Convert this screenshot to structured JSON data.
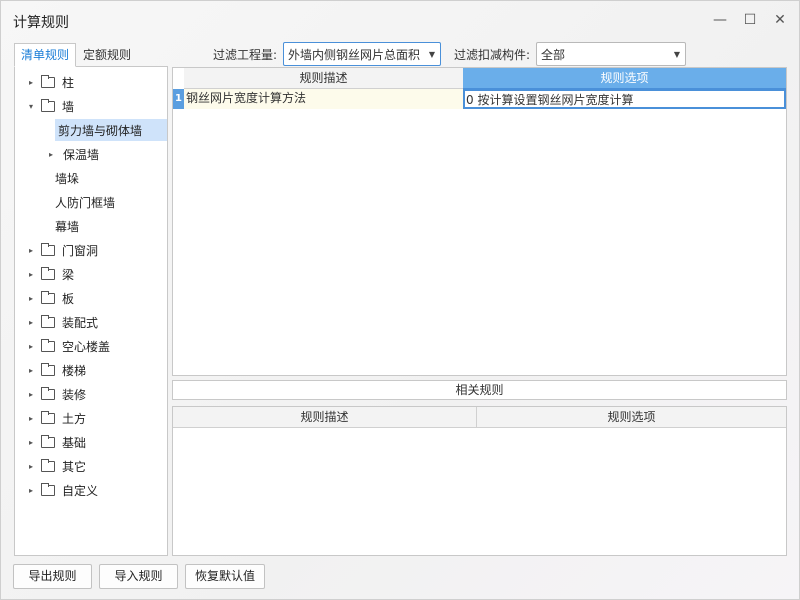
{
  "window": {
    "title": "计算规则"
  },
  "tabs": [
    {
      "label": "清单规则",
      "active": true
    },
    {
      "label": "定额规则",
      "active": false
    }
  ],
  "filters": {
    "quantity_label": "过滤工程量:",
    "quantity_value": "外墙内侧钢丝网片总面积",
    "component_label": "过滤扣减构件:",
    "component_value": "全部"
  },
  "tree": [
    {
      "label": "柱",
      "expandable": true,
      "expanded": false,
      "folder": true,
      "level": 0
    },
    {
      "label": "墙",
      "expandable": true,
      "expanded": true,
      "folder": true,
      "level": 0
    },
    {
      "label": "剪力墙与砌体墙",
      "expandable": false,
      "folder": false,
      "level": 1,
      "selected": true
    },
    {
      "label": "保温墙",
      "expandable": true,
      "expanded": false,
      "folder": false,
      "level": 1
    },
    {
      "label": "墙垛",
      "expandable": false,
      "folder": false,
      "level": 1
    },
    {
      "label": "人防门框墙",
      "expandable": false,
      "folder": false,
      "level": 1
    },
    {
      "label": "幕墙",
      "expandable": false,
      "folder": false,
      "level": 1
    },
    {
      "label": "门窗洞",
      "expandable": true,
      "expanded": false,
      "folder": true,
      "level": 0
    },
    {
      "label": "梁",
      "expandable": true,
      "expanded": false,
      "folder": true,
      "level": 0
    },
    {
      "label": "板",
      "expandable": true,
      "expanded": false,
      "folder": true,
      "level": 0
    },
    {
      "label": "装配式",
      "expandable": true,
      "expanded": false,
      "folder": true,
      "level": 0
    },
    {
      "label": "空心楼盖",
      "expandable": true,
      "expanded": false,
      "folder": true,
      "level": 0
    },
    {
      "label": "楼梯",
      "expandable": true,
      "expanded": false,
      "folder": true,
      "level": 0
    },
    {
      "label": "装修",
      "expandable": true,
      "expanded": false,
      "folder": true,
      "level": 0
    },
    {
      "label": "土方",
      "expandable": true,
      "expanded": false,
      "folder": true,
      "level": 0
    },
    {
      "label": "基础",
      "expandable": true,
      "expanded": false,
      "folder": true,
      "level": 0
    },
    {
      "label": "其它",
      "expandable": true,
      "expanded": false,
      "folder": true,
      "level": 0
    },
    {
      "label": "自定义",
      "expandable": true,
      "expanded": false,
      "folder": true,
      "level": 0
    }
  ],
  "rules_grid": {
    "headers": [
      "规则描述",
      "规则选项"
    ],
    "rows": [
      {
        "index": "1",
        "description": "钢丝网片宽度计算方法",
        "option": "0   按计算设置钢丝网片宽度计算"
      }
    ]
  },
  "related": {
    "title": "相关规则",
    "headers": [
      "规则描述",
      "规则选项"
    ]
  },
  "buttons": {
    "export": "导出规则",
    "import": "导入规则",
    "restore": "恢复默认值"
  },
  "icons": {
    "minimize": "minimize-icon",
    "maximize": "maximize-icon",
    "close": "close-icon",
    "folder": "folder-icon",
    "expand": "expand-arrow-icon",
    "collapse": "collapse-arrow-icon",
    "dropdown": "chevron-down-icon"
  }
}
